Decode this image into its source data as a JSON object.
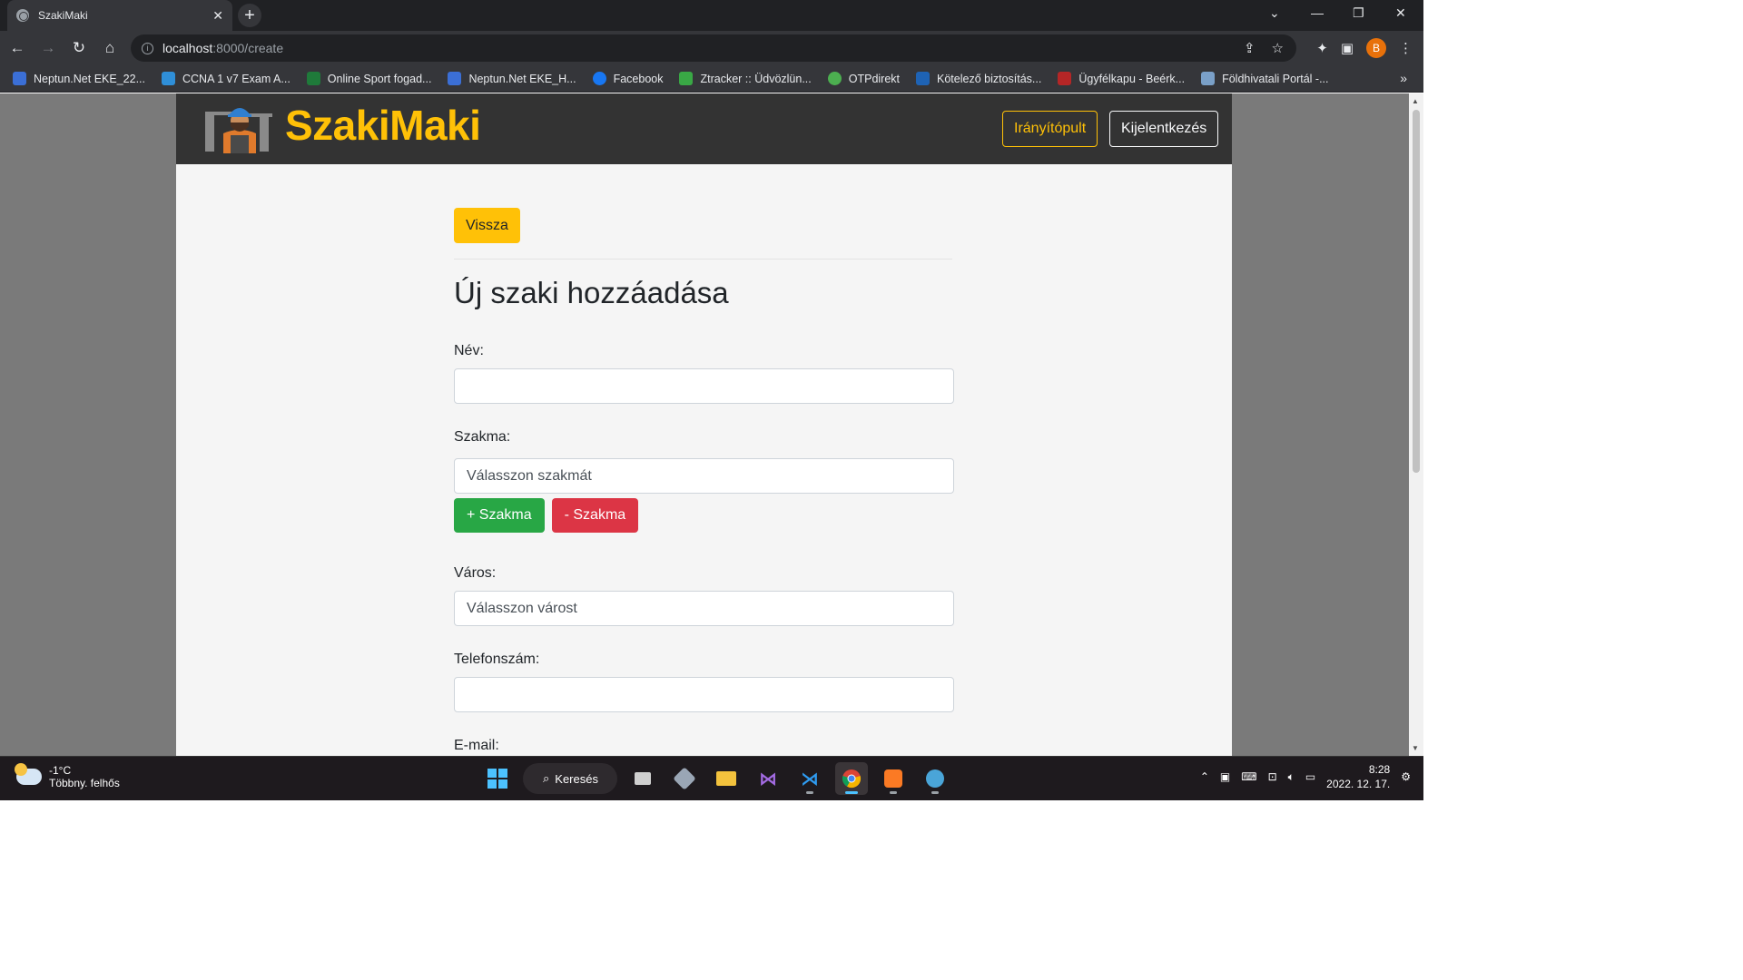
{
  "browser": {
    "tab_title": "SzakiMaki",
    "tab_close": "✕",
    "new_tab": "+",
    "url_host": "localhost",
    "url_rest": ":8000/create",
    "profile_initial": "B",
    "bookmarks": [
      {
        "label": "Neptun.Net EKE_22...",
        "color": "#3b6fd6"
      },
      {
        "label": "CCNA 1 v7 Exam A...",
        "color": "#2f8fd8"
      },
      {
        "label": "Online Sport fogad...",
        "color": "#1f7a3a"
      },
      {
        "label": "Neptun.Net EKE_H...",
        "color": "#3b6fd6"
      },
      {
        "label": "Facebook",
        "color": "#1877f2"
      },
      {
        "label": "Ztracker :: Üdvözlün...",
        "color": "#39a845"
      },
      {
        "label": "OTPdirekt",
        "color": "#4caf50"
      },
      {
        "label": "Kötelező biztosítás...",
        "color": "#1e63b5"
      },
      {
        "label": "Ügyfélkapu - Beérk...",
        "color": "#b52626"
      },
      {
        "label": "Földhivatali Portál -...",
        "color": "#7aa0c8"
      }
    ],
    "bookmarks_more": "»"
  },
  "site": {
    "brand": "SzakiMaki",
    "nav_dashboard": "Irányítópult",
    "nav_logout": "Kijelentkezés",
    "back_button": "Vissza",
    "heading": "Új szaki hozzáadása",
    "name_label": "Név:",
    "trade_label": "Szakma:",
    "trade_placeholder": "Válasszon szakmát",
    "add_trade": "+ Szakma",
    "remove_trade": "- Szakma",
    "city_label": "Város:",
    "city_placeholder": "Válasszon várost",
    "phone_label": "Telefonszám:",
    "email_label": "E-mail:"
  },
  "taskbar": {
    "temperature": "-1°C",
    "weather_desc": "Többny. felhős",
    "search_label": "Keresés",
    "time": "8:28",
    "date": "2022. 12. 17."
  }
}
